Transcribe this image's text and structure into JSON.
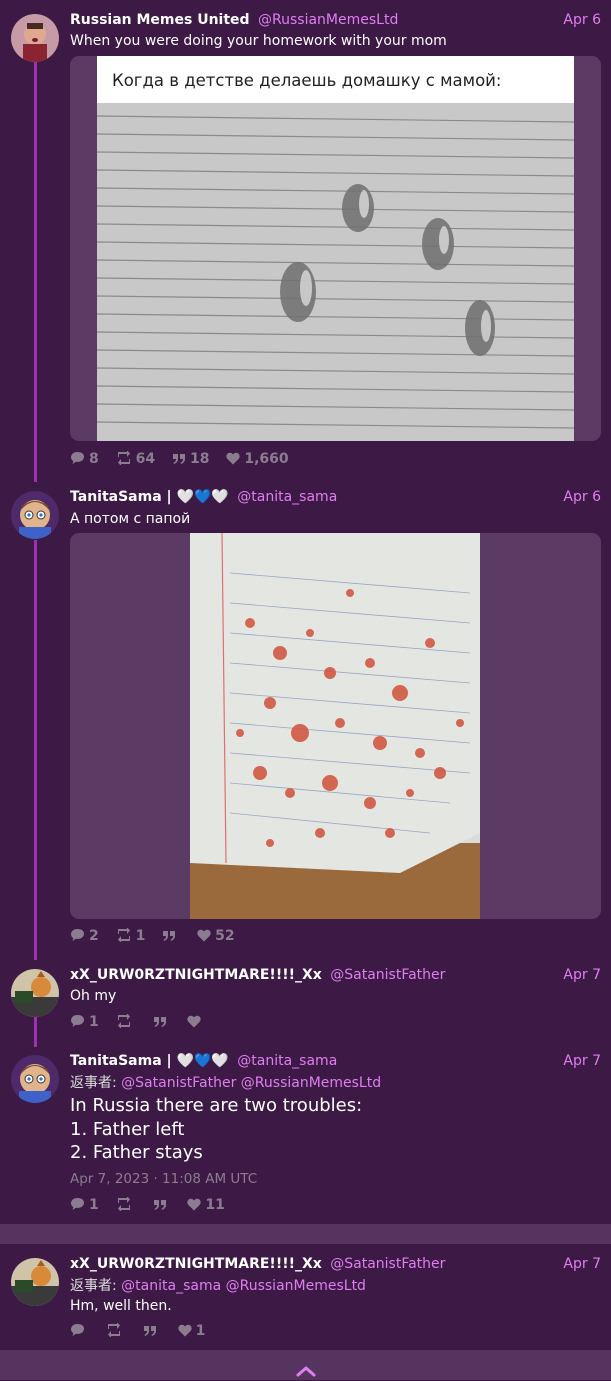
{
  "colors": {
    "background": "#3c1a45",
    "accent": "#e07ef0",
    "thread": "#a12fb5",
    "muted": "#8c7c90",
    "panel": "#553560"
  },
  "tweets": [
    {
      "fullname": "Russian Memes United",
      "username": "@RussianMemesLtd",
      "date": "Apr 6",
      "text": "When you were doing your homework with your mom",
      "image_caption": "Когда в детстве делаешь домашку с мамой:",
      "stats": {
        "replies": "8",
        "retweets": "64",
        "quotes": "18",
        "likes": "1,660"
      }
    },
    {
      "fullname": "TanitaSama | 🤍💙🤍",
      "username": "@tanita_sama",
      "date": "Apr 6",
      "text": "А потом с папой",
      "stats": {
        "replies": "2",
        "retweets": "1",
        "quotes": "",
        "likes": "52"
      }
    },
    {
      "fullname": "xX_URW0RZTNIGHTMARE!!!!_Xx",
      "username": "@SatanistFather",
      "date": "Apr 7",
      "text": "Oh my",
      "stats": {
        "replies": "1",
        "retweets": "",
        "quotes": "",
        "likes": ""
      }
    },
    {
      "fullname": "TanitaSama | 🤍💙🤍",
      "username": "@tanita_sama",
      "date": "Apr 7",
      "reply_label": "返事者:",
      "reply_mentions": [
        "@SatanistFather",
        "@RussianMemesLtd"
      ],
      "lines": [
        "In Russia there are two troubles:",
        "1. Father left",
        "2. Father stays"
      ],
      "timestamp": "Apr 7, 2023 · 11:08 AM UTC",
      "stats": {
        "replies": "1",
        "retweets": "",
        "quotes": "",
        "likes": "11"
      }
    },
    {
      "fullname": "xX_URW0RZTNIGHTMARE!!!!_Xx",
      "username": "@SatanistFather",
      "date": "Apr 7",
      "reply_label": "返事者:",
      "reply_mentions": [
        "@tanita_sama",
        "@RussianMemesLtd"
      ],
      "text": "Hm, well then.",
      "stats": {
        "replies": "",
        "retweets": "",
        "quotes": "",
        "likes": "1"
      }
    }
  ],
  "icons": [
    "comment-icon",
    "retweet-icon",
    "quote-icon",
    "heart-icon",
    "chevron-up-icon"
  ]
}
